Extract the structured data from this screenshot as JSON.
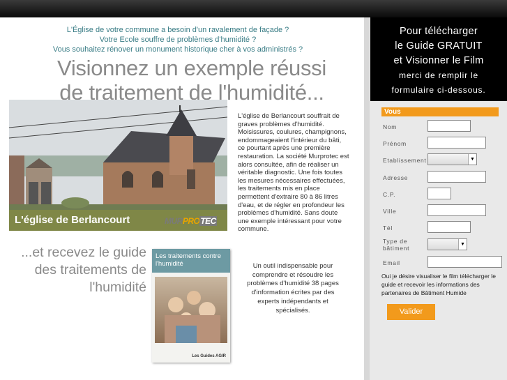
{
  "intro": [
    "L'Église de votre commune a besoin d'un ravalement de façade ?",
    "Votre Ecole souffre de problèmes d'humidité ?",
    "Vous souhaitez rénover un monument historique cher à vos administrés ?"
  ],
  "headline": [
    "Visionnez un exemple réussi",
    "de traitement de l'humidité..."
  ],
  "photo": {
    "caption": "L'église de Berlancourt",
    "logo": {
      "a": "MUR",
      "b": "PRO",
      "c": "TEC"
    }
  },
  "story": "L'église de Berlancourt souffrait de graves problèmes d'humidité. Moisissures, coulures, champignons, endommageaient l'intérieur du bâti, ce pourtant après une première restauration. La société Murprotec est alors consultée, afin de réaliser un véritable diagnostic. Une fois toutes les mesures nécessaires effectuées, les traitements mis en place permettent d'extraire 80 à 86 litres d'eau, et de régler en profondeur les problèmes d'humidité. Sans doute une exemple intéressant pour votre commune.",
  "guide": {
    "lines": [
      "...et recevez le guide",
      "des traitements de",
      "l'humidité"
    ],
    "book_title": "Les traitements contre l'humidité",
    "book_brand": "Les Guides AGIR",
    "description": "Un outil indispensable pour comprendre et résoudre les problèmes d'humidité 38 pages d'information écrites par des experts indépendants et spécialisés."
  },
  "side": {
    "lines_big": [
      "Pour télécharger",
      "le Guide GRATUIT",
      "et Visionner le Film"
    ],
    "lines_small": [
      "merci de remplir le",
      "formulaire ci-dessous."
    ]
  },
  "form": {
    "section": "Vous",
    "labels": {
      "nom": "Nom",
      "prenom": "Prénom",
      "etablissement": "Etablissement",
      "adresse": "Adresse",
      "cp": "C.P.",
      "ville": "Ville",
      "tel": "Tél",
      "type": "Type de bâtiment",
      "email": "Email"
    },
    "consent": "Oui je désire visualiser le film télécharger le guide et recevoir les informations des partenaires de Bâtiment Humide",
    "submit": "Valider"
  }
}
